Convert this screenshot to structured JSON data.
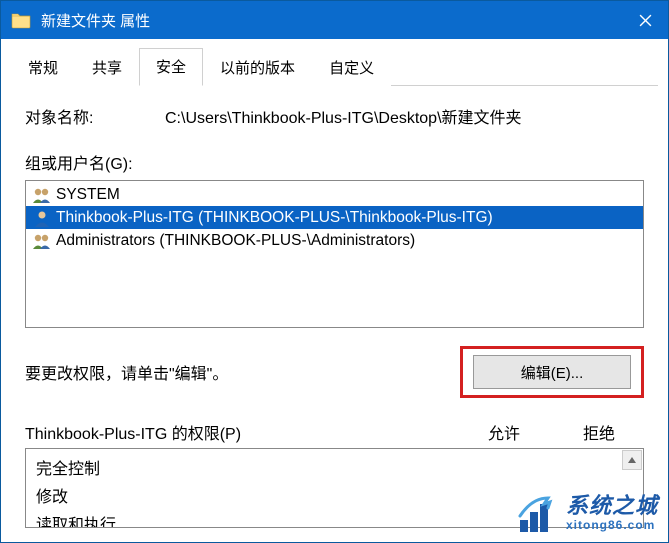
{
  "window": {
    "title": "新建文件夹 属性"
  },
  "tabs": {
    "items": [
      "常规",
      "共享",
      "安全",
      "以前的版本",
      "自定义"
    ],
    "active_index": 2
  },
  "object": {
    "label": "对象名称:",
    "value": "C:\\Users\\Thinkbook-Plus-ITG\\Desktop\\新建文件夹"
  },
  "groups": {
    "label": "组或用户名(G):",
    "items": [
      {
        "icon": "group-icon",
        "text": "SYSTEM",
        "selected": false
      },
      {
        "icon": "user-icon",
        "text": "Thinkbook-Plus-ITG (THINKBOOK-PLUS-\\Thinkbook-Plus-ITG)",
        "selected": true
      },
      {
        "icon": "group-icon",
        "text": "Administrators (THINKBOOK-PLUS-\\Administrators)",
        "selected": false
      }
    ]
  },
  "edit_hint": "要更改权限，请单击\"编辑\"。",
  "edit_button": "编辑(E)...",
  "permissions": {
    "header_label": "Thinkbook-Plus-ITG 的权限(P)",
    "allow_label": "允许",
    "deny_label": "拒绝",
    "rows": [
      "完全控制",
      "修改",
      "读取和执行"
    ]
  },
  "watermark": {
    "title": "系统之城",
    "domain": "xitong86.com"
  }
}
